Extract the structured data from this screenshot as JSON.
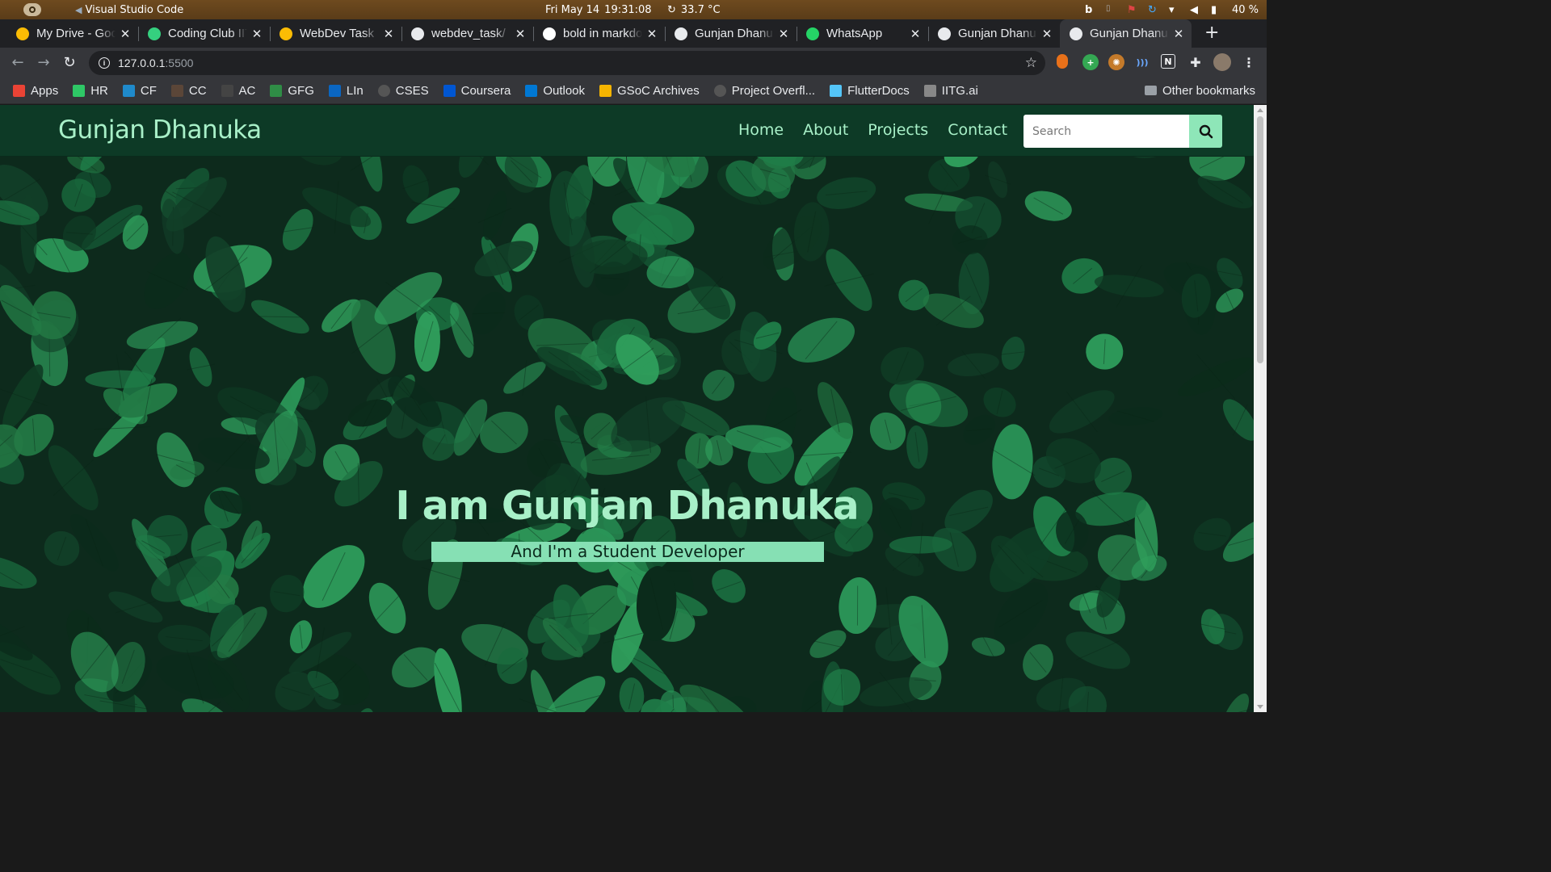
{
  "system_bar": {
    "app_name": "Visual Studio Code",
    "date": "Fri May 14",
    "time": "19:31:08",
    "temperature": "33.7 °C",
    "battery": "40 %"
  },
  "tabs": [
    {
      "title": "My Drive - Goo",
      "icon": "google-drive-icon",
      "color": "#fbbc04"
    },
    {
      "title": "Coding Club IIT",
      "icon": "coding-club-icon",
      "color": "#35d07f"
    },
    {
      "title": "WebDev Task",
      "icon": "google-drive-icon",
      "color": "#fbbc04"
    },
    {
      "title": "webdev_task/",
      "icon": "github-icon",
      "color": "#e8eaed"
    },
    {
      "title": "bold in markdo",
      "icon": "google-icon",
      "color": "#ffffff"
    },
    {
      "title": "Gunjan Dhanu",
      "icon": "globe-icon",
      "color": "#e8eaed"
    },
    {
      "title": "WhatsApp",
      "icon": "whatsapp-icon",
      "color": "#25d366"
    },
    {
      "title": "Gunjan Dhanu",
      "icon": "globe-icon",
      "color": "#e8eaed"
    },
    {
      "title": "Gunjan Dhanu",
      "icon": "globe-icon",
      "color": "#e8eaed",
      "active": true
    }
  ],
  "address_bar": {
    "host": "127.0.0.1",
    "port": ":5500"
  },
  "bookmarks": [
    {
      "label": "Apps",
      "icon": "apps-grid-icon"
    },
    {
      "label": "HR",
      "icon": "hackerrank-icon"
    },
    {
      "label": "CF",
      "icon": "codeforces-icon"
    },
    {
      "label": "CC",
      "icon": "codechef-icon"
    },
    {
      "label": "AC",
      "icon": "atcoder-icon"
    },
    {
      "label": "GFG",
      "icon": "gfg-icon"
    },
    {
      "label": "LIn",
      "icon": "linkedin-icon"
    },
    {
      "label": "CSES",
      "icon": "globe-icon"
    },
    {
      "label": "Coursera",
      "icon": "coursera-icon"
    },
    {
      "label": "Outlook",
      "icon": "outlook-icon"
    },
    {
      "label": "GSoC Archives",
      "icon": "gsoc-icon"
    },
    {
      "label": "Project Overfl...",
      "icon": "globe-icon"
    },
    {
      "label": "FlutterDocs",
      "icon": "flutter-icon"
    },
    {
      "label": "IITG.ai",
      "icon": "iitg-ai-icon"
    }
  ],
  "other_bookmarks": "Other bookmarks",
  "site": {
    "brand": "Gunjan Dhanuka",
    "nav": [
      "Home",
      "About",
      "Projects",
      "Contact"
    ],
    "search_placeholder": "Search",
    "headline": "I am Gunjan Dhanuka",
    "subheadline": "And I'm a Student Developer"
  },
  "colors": {
    "accent_text": "#a8f0c8",
    "accent_bg": "#86e0b4",
    "navbar_bg": "#0d3a26"
  }
}
